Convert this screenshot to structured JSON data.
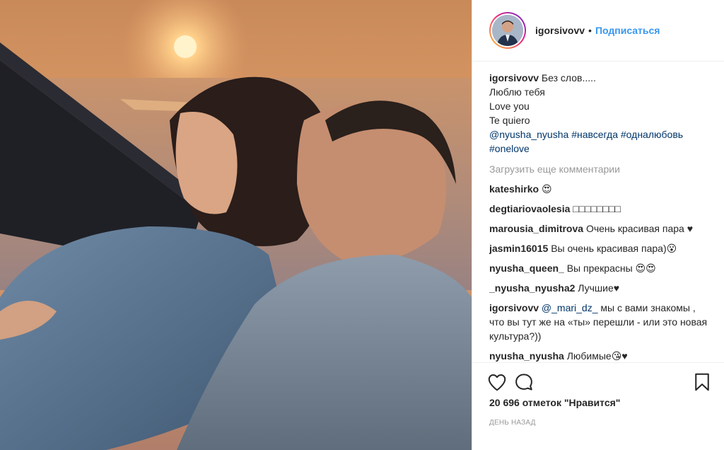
{
  "header": {
    "username": "igorsivovv",
    "separator": "•",
    "follow_label": "Подписаться"
  },
  "caption": {
    "username": "igorsivovv",
    "line1": "Без слов.....",
    "line2": "Люблю тебя",
    "line3": "Love you",
    "line4": "Te quiero",
    "mention": "@nyusha_nyusha",
    "tag1": "#навсегда",
    "tag2": "#одналюбовь",
    "tag3": "#onelove"
  },
  "load_more_label": "Загрузить еще комментарии",
  "comments": [
    {
      "user": "kateshirko",
      "text": "😍"
    },
    {
      "user": "degtiariovaolesia",
      "text": "□□□□□□□□"
    },
    {
      "user": "marousia_dimitrova",
      "text": "Очень красивая пара ♥"
    },
    {
      "user": "jasmin16015",
      "text": "Вы очень красивая пара)😮"
    },
    {
      "user": "nyusha_queen_",
      "text": "Вы прекрасны 😍😍"
    },
    {
      "user": "_nyusha_nyusha2",
      "text": "Лучшие♥"
    },
    {
      "user": "igorsivovv",
      "mention": "@_mari_dz_",
      "text": "мы с вами знакомы , что вы тут же на «ты» перешли - или это новая культура?))"
    },
    {
      "user": "nyusha_nyusha",
      "text": "Любимые😘♥"
    }
  ],
  "likes_text": "20 696 отметок \"Нравится\"",
  "time_text": "день назад",
  "icons": [
    "heart-icon",
    "comment-icon",
    "bookmark-icon"
  ],
  "colors": {
    "link": "#3897f0",
    "hashtag": "#003569",
    "muted": "#999999"
  }
}
